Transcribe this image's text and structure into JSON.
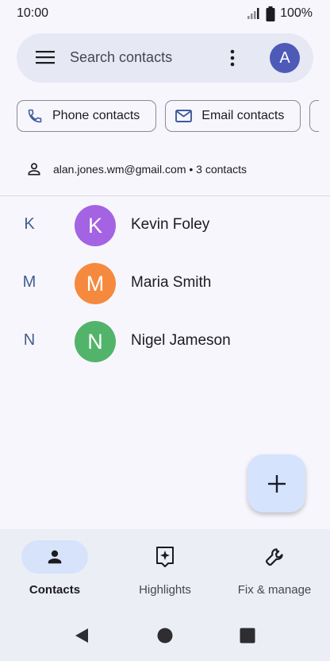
{
  "status_bar": {
    "time": "10:00",
    "battery": "100%"
  },
  "search": {
    "placeholder": "Search contacts",
    "avatar_letter": "A",
    "avatar_color": "#4e5ab8"
  },
  "chips": [
    {
      "label": "Phone contacts",
      "icon": "phone-icon"
    },
    {
      "label": "Email contacts",
      "icon": "mail-icon"
    }
  ],
  "account": {
    "text": "alan.jones.wm@gmail.com • 3 contacts",
    "icon": "person-outline-icon"
  },
  "contacts": [
    {
      "letter": "K",
      "initial": "K",
      "name": "Kevin Foley",
      "color": "#a463e3"
    },
    {
      "letter": "M",
      "initial": "M",
      "name": "Maria Smith",
      "color": "#f58a3f"
    },
    {
      "letter": "N",
      "initial": "N",
      "name": "Nigel Jameson",
      "color": "#52b46a"
    }
  ],
  "fab": {
    "icon": "plus-icon"
  },
  "bottom_nav": [
    {
      "label": "Contacts",
      "icon": "person-icon",
      "active": true
    },
    {
      "label": "Highlights",
      "icon": "highlights-icon",
      "active": false
    },
    {
      "label": "Fix & manage",
      "icon": "wrench-icon",
      "active": false
    }
  ],
  "system_nav": [
    "back-icon",
    "home-icon",
    "recents-icon"
  ]
}
